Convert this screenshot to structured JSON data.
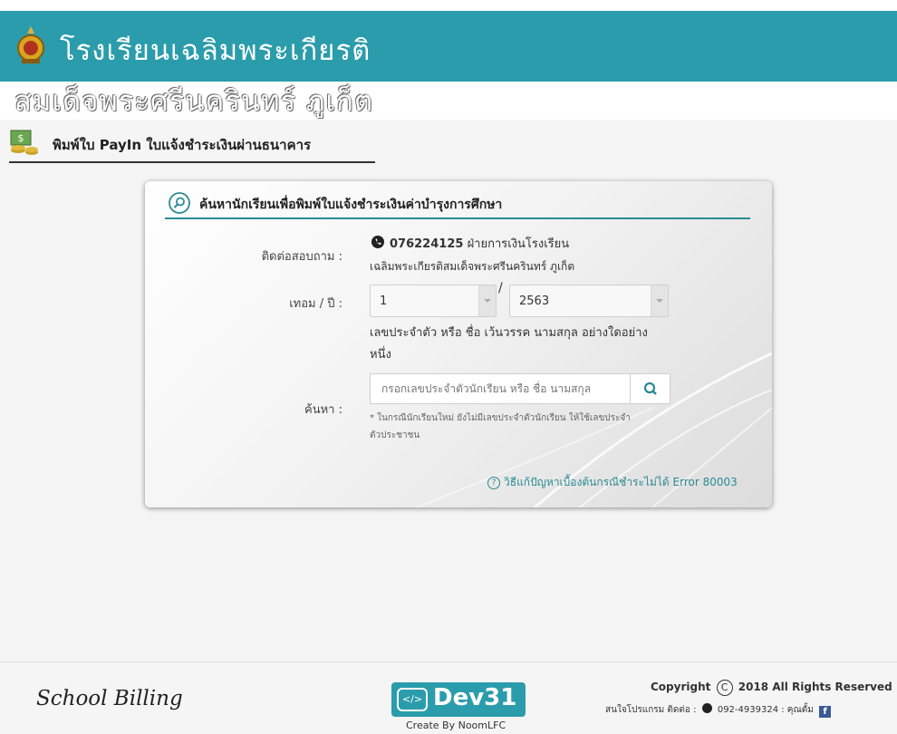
{
  "header": {
    "school_line1": "โรงเรียนเฉลิมพระเกียรติ",
    "school_line2": "สมเด็จพระศรีนครินทร์ ภูเก็ต"
  },
  "page": {
    "heading": "พิมพ์ใบ PayIn ใบแจ้งชำระเงินผ่านธนาคาร"
  },
  "card": {
    "title": "ค้นหานักเรียนเพื่อพิมพ์ใบแจ้งชำระเงินค่าบำรุงการศึกษา",
    "contact_label": "ติดต่อสอบถาม :",
    "contact_phone": "076224125",
    "contact_dept": "ฝ่ายการเงินโรงเรียน",
    "contact_school": "เฉลิมพระเกียรติสมเด็จพระศรีนครินทร์ ภูเก็ต",
    "term_label": "เทอม / ปี :",
    "term_value": "1",
    "year_value": "2563",
    "hint_line1": "เลขประจำตัว หรือ ชื่อ เว้นวรรค นามสกุล อย่างใดอย่าง",
    "hint_line2": "หนึ่ง",
    "search_label": "ค้นหา :",
    "search_placeholder": "กรอกเลขประจำตัวนักเรียน หรือ ชื่อ นามสกุล",
    "note_line1": "* ในกรณีนักเรียนใหม่ ยังไม่มีเลขประจำตัวนักเรียน ให้ใช้เลขประจำ",
    "note_line2": "ตัวประชาชน",
    "help_link": "วิธีแก้ปัญหาเบื้องต้นกรณีชำระไม่ได้ Error 80003"
  },
  "footer": {
    "brand": "School Billing",
    "dev_logo": "Dev31",
    "dev_code": "</>",
    "created_by": "Create By NoomLFC",
    "copyright_pre": "Copyright",
    "copyright_symbol": "C",
    "copyright_post": "2018 All Rights Reserved",
    "system_contact_pre": "สนใจโปรแกรม ติดต่อ :",
    "system_phone": "092-4939324",
    "system_contact_post": ": คุณตั้ม",
    "fb_letter": "f"
  },
  "colors": {
    "header_teal": "#2b9cab",
    "accent": "#2b8a94"
  },
  "icons": [
    "school-logo-icon",
    "money-icon",
    "search-circle-icon",
    "phone-icon",
    "search-icon",
    "help-icon",
    "code-icon",
    "facebook-icon"
  ]
}
